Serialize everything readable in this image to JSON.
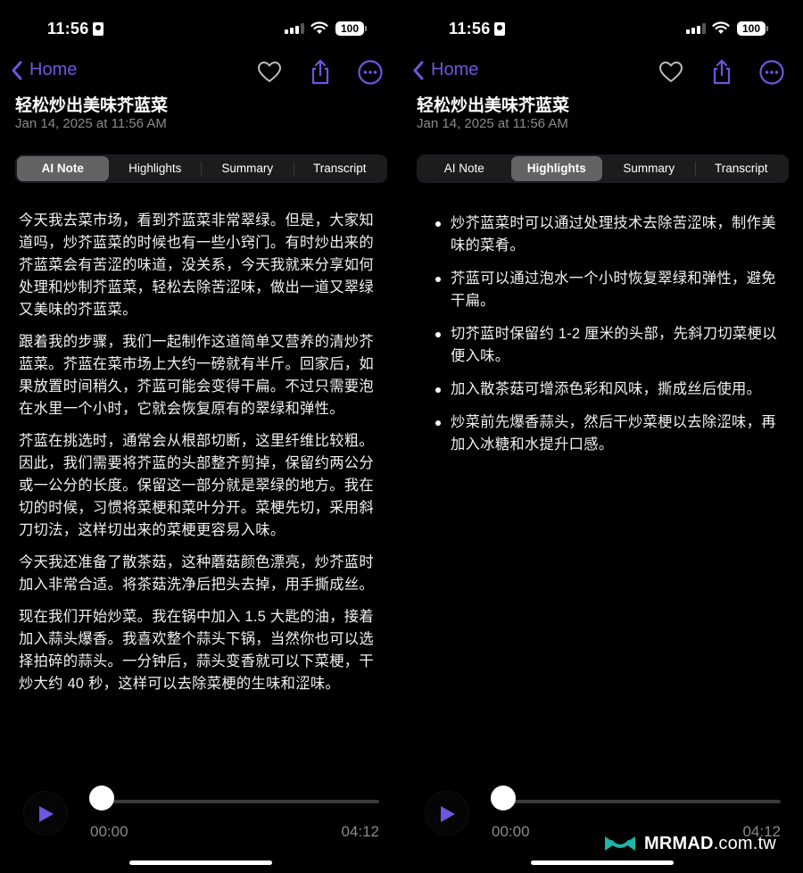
{
  "status_bar": {
    "time": "11:56",
    "battery": "100"
  },
  "nav": {
    "back_label": "Home"
  },
  "note": {
    "title": "轻松炒出美味芥蓝菜",
    "date": "Jan 14, 2025 at 11:56 AM"
  },
  "tabs": [
    {
      "label": "AI Note"
    },
    {
      "label": "Highlights"
    },
    {
      "label": "Summary"
    },
    {
      "label": "Transcript"
    }
  ],
  "screens": [
    {
      "active_tab": "AI Note"
    },
    {
      "active_tab": "Highlights"
    }
  ],
  "ai_note": {
    "paragraphs": [
      "今天我去菜市场，看到芥蓝菜非常翠绿。但是，大家知道吗，炒芥蓝菜的时候也有一些小窍门。有时炒出来的芥蓝菜会有苦涩的味道，没关系，今天我就来分享如何处理和炒制芥蓝菜，轻松去除苦涩味，做出一道又翠绿又美味的芥蓝菜。",
      "跟着我的步骤，我们一起制作这道简单又营养的清炒芥蓝菜。芥蓝在菜市场上大约一磅就有半斤。回家后，如果放置时间稍久，芥蓝可能会变得干扁。不过只需要泡在水里一个小时，它就会恢复原有的翠绿和弹性。",
      "芥蓝在挑选时，通常会从根部切断，这里纤维比较粗。因此，我们需要将芥蓝的头部整齐剪掉，保留约两公分或一公分的长度。保留这一部分就是翠绿的地方。我在切的时候，习惯将菜梗和菜叶分开。菜梗先切，采用斜刀切法，这样切出来的菜梗更容易入味。",
      "今天我还准备了散茶菇，这种蘑菇颜色漂亮，炒芥蓝时加入非常合适。将茶菇洗净后把头去掉，用手撕成丝。",
      "现在我们开始炒菜。我在锅中加入 1.5 大匙的油，接着加入蒜头爆香。我喜欢整个蒜头下锅，当然你也可以选择拍碎的蒜头。一分钟后，蒜头变香就可以下菜梗，干炒大约 40 秒，这样可以去除菜梗的生味和涩味。"
    ]
  },
  "highlights": {
    "items": [
      "炒芥蓝菜时可以通过处理技术去除苦涩味，制作美味的菜肴。",
      "芥蓝可以通过泡水一个小时恢复翠绿和弹性，避免干扁。",
      "切芥蓝时保留约 1-2 厘米的头部，先斜刀切菜梗以便入味。",
      "加入散茶菇可增添色彩和风味，撕成丝后使用。",
      "炒菜前先爆香蒜头，然后干炒菜梗以去除涩味，再加入冰糖和水提升口感。"
    ]
  },
  "player": {
    "current_time": "00:00",
    "duration": "04:12",
    "progress": 0
  },
  "icons": {
    "back": "chevron-left-icon",
    "favorite": "heart-icon",
    "share": "share-icon",
    "more": "ellipsis-circle-icon",
    "play": "play-icon"
  },
  "colors": {
    "accent": "#6b57e0",
    "background": "#000000",
    "secondary_text": "#8a8a8e",
    "segment_bg": "#1c1c1e",
    "segment_active": "#636366",
    "watermark_teal": "#1fb5a8"
  },
  "watermark": {
    "brand": "MRMAD",
    "domain": ".com.tw"
  }
}
